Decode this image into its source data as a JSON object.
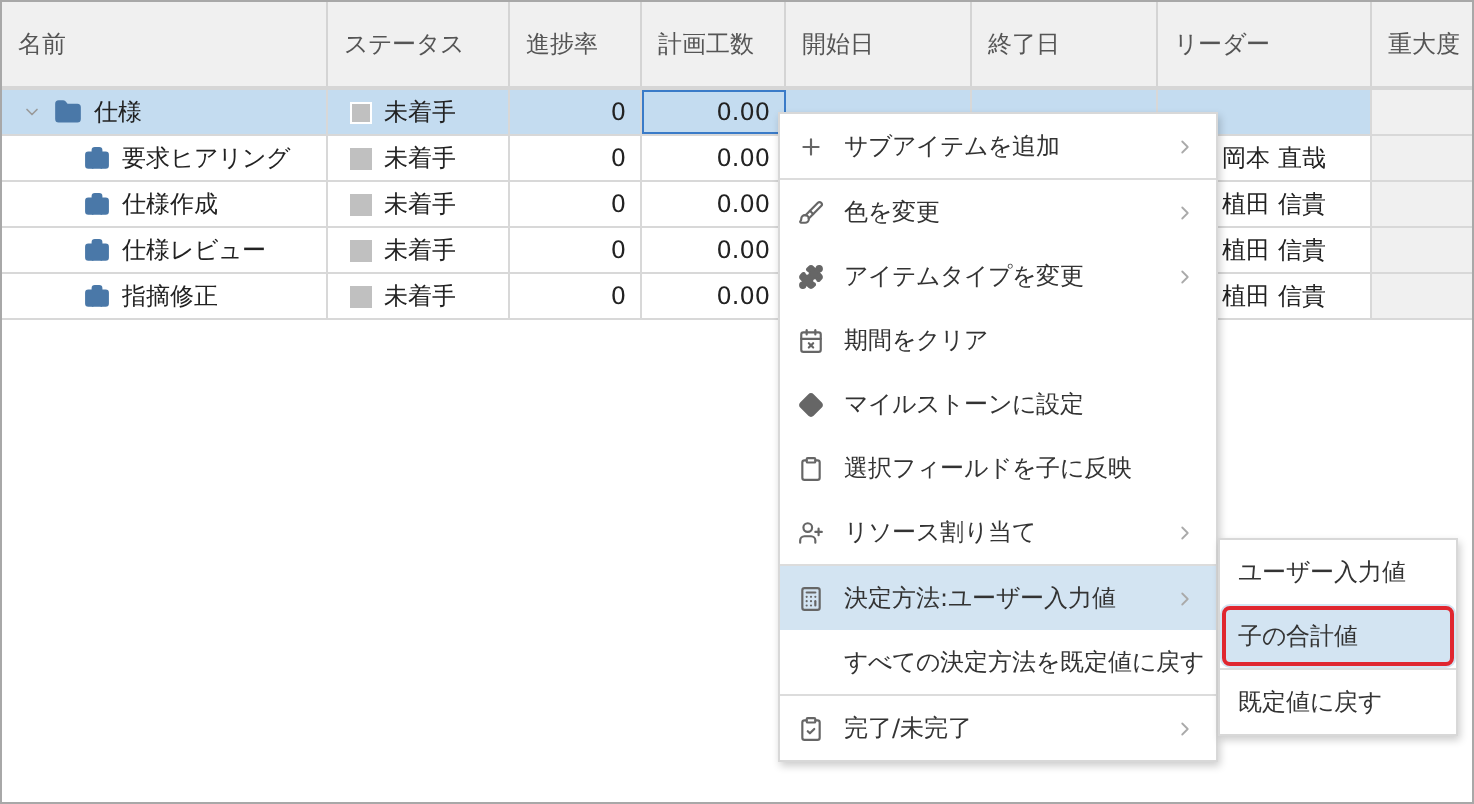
{
  "table": {
    "columns": [
      "名前",
      "ステータス",
      "進捗率",
      "計画工数",
      "開始日",
      "終了日",
      "リーダー",
      "重大度"
    ],
    "rows": [
      {
        "name": "仕様",
        "kind": "folder",
        "selected": true,
        "expanded": true,
        "status": "未着手",
        "progress": "0",
        "effort": "0.00",
        "leader": "",
        "children": [
          {
            "name": "要求ヒアリング",
            "kind": "task",
            "selected": false,
            "status": "未着手",
            "progress": "0",
            "effort": "0.00",
            "leader": "岡本 直哉"
          },
          {
            "name": "仕様作成",
            "kind": "task",
            "selected": false,
            "status": "未着手",
            "progress": "0",
            "effort": "0.00",
            "leader": "植田 信貴"
          },
          {
            "name": "仕様レビュー",
            "kind": "task",
            "selected": false,
            "status": "未着手",
            "progress": "0",
            "effort": "0.00",
            "leader": "植田 信貴"
          },
          {
            "name": "指摘修正",
            "kind": "task",
            "selected": false,
            "status": "未着手",
            "progress": "0",
            "effort": "0.00",
            "leader": "植田 信貴"
          }
        ]
      }
    ]
  },
  "context_menu": {
    "items": [
      {
        "label": "サブアイテムを追加",
        "kind": "plus",
        "has_submenu": true,
        "selected": false,
        "separator_after": true
      },
      {
        "label": "色を変更",
        "kind": "brush",
        "has_submenu": true,
        "selected": false
      },
      {
        "label": "アイテムタイプを変更",
        "kind": "puzzle",
        "has_submenu": true,
        "selected": false
      },
      {
        "label": "期間をクリア",
        "kind": "calendar-x",
        "has_submenu": false,
        "selected": false
      },
      {
        "label": "マイルストーンに設定",
        "kind": "diamond",
        "has_submenu": false,
        "selected": false
      },
      {
        "label": "選択フィールドを子に反映",
        "kind": "clipboard",
        "has_submenu": false,
        "selected": false
      },
      {
        "label": "リソース割り当て",
        "kind": "user-plus",
        "has_submenu": true,
        "selected": false,
        "separator_after": true
      },
      {
        "label": "決定方法:ユーザー入力値",
        "kind": "calculator",
        "has_submenu": true,
        "selected": true,
        "submenu": [
          {
            "label": "ユーザー入力値",
            "selected": false,
            "outlined": false
          },
          {
            "label": "子の合計値",
            "selected": true,
            "outlined": true,
            "separator_after": true
          },
          {
            "label": "既定値に戻す",
            "selected": false,
            "outlined": false
          }
        ]
      },
      {
        "label": "すべての決定方法を既定値に戻す",
        "kind": "plain",
        "has_submenu": false,
        "selected": false,
        "separator_after": true
      },
      {
        "label": "完了/未完了",
        "kind": "clipboard-check",
        "has_submenu": true,
        "selected": false
      }
    ]
  }
}
